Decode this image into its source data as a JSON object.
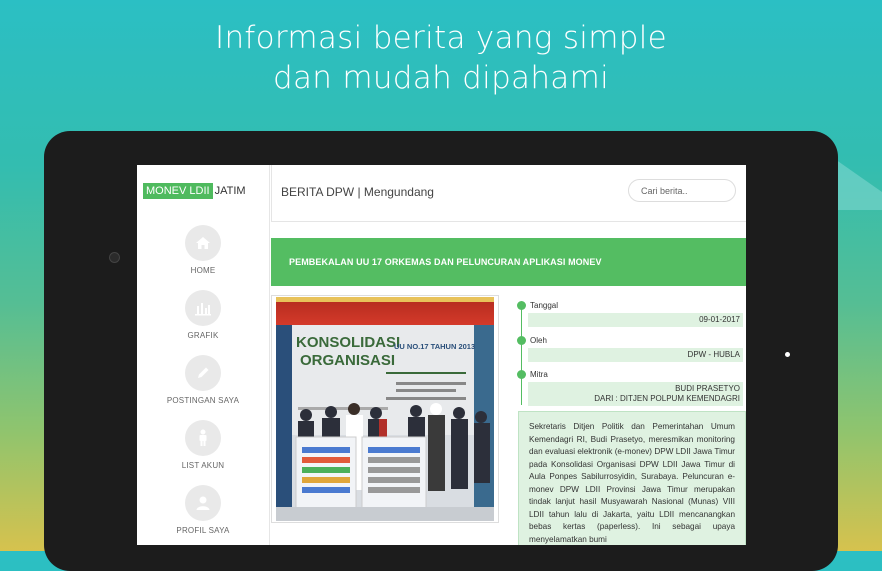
{
  "headline": {
    "line1": "Informasi berita yang simple",
    "line2": "dan mudah dipahami"
  },
  "app": {
    "brand_tag": "MONEV LDII",
    "brand_rest": "JATIM"
  },
  "sidebar": {
    "items": [
      {
        "label": "HOME",
        "icon": "home-icon"
      },
      {
        "label": "GRAFIK",
        "icon": "bar-chart-icon"
      },
      {
        "label": "POSTINGAN SAYA",
        "icon": "pencil-icon"
      },
      {
        "label": "LIST AKUN",
        "icon": "person-icon"
      },
      {
        "label": "PROFIL SAYA",
        "icon": "user-avatar-icon"
      }
    ]
  },
  "topbar": {
    "breadcrumb": "BERITA DPW | Mengundang",
    "search_placeholder": "Cari berita.."
  },
  "article": {
    "title": "PEMBEKALAN UU 17 ORKEMAS DAN PELUNCURAN APLIKASI MONEV",
    "photo": {
      "heading": "KONSOLIDASI ORGANISASI",
      "subheading": "UU NO.17 TAHUN 2013"
    },
    "meta": [
      {
        "label": "Tanggal",
        "value": "09-01-2017"
      },
      {
        "label": "Oleh",
        "value": "DPW - HUBLA"
      },
      {
        "label": "Mitra",
        "value": "BUDI PRASETYO",
        "value2": "DARI : DITJEN POLPUM KEMENDAGRI"
      }
    ],
    "body": "Sekretaris Ditjen Politik dan Pemerintahan Umum Kemendagri RI, Budi Prasetyo, meresmikan monitoring dan evaluasi elektronik (e-monev) DPW LDII Jawa Timur pada Konsolidasi Organisasi DPW LDII Jawa Timur di Aula Ponpes Sabilurrosyidin, Surabaya. Peluncuran e-monev DPW LDII Provinsi Jawa Timur merupakan tindak lanjut hasil Musyawarah Nasional (Munas) VIII LDII tahun lalu di Jakarta, yaitu LDII mencanangkan bebas kertas (paperless). Ini sebagai upaya menyelamatkan bumi"
  },
  "colors": {
    "accent": "#54bd62",
    "light_accent": "#dff2e1"
  }
}
